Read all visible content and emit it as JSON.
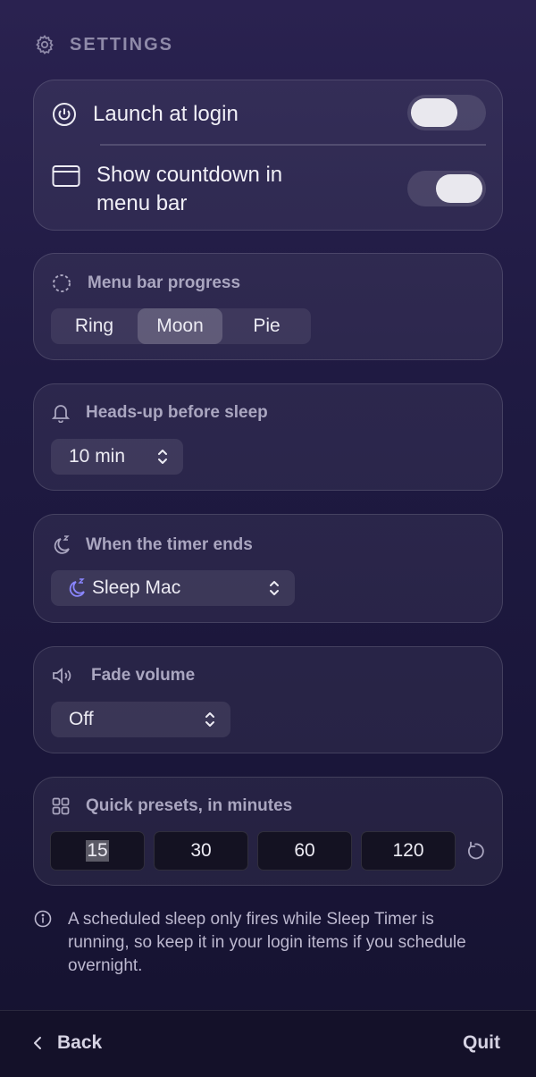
{
  "header": {
    "title": "SETTINGS",
    "icon": "gear-icon"
  },
  "general": {
    "launch_at_login": {
      "label": "Launch at login",
      "enabled": false,
      "icon": "power-icon"
    },
    "show_countdown": {
      "label_line1": "Show countdown in",
      "label_line2": "menu bar",
      "enabled": true,
      "icon": "window-icon"
    }
  },
  "menu_bar_progress": {
    "label": "Menu bar progress",
    "icon": "dashed-circle-icon",
    "options": [
      "Ring",
      "Moon",
      "Pie"
    ],
    "selected": "Moon"
  },
  "heads_up": {
    "label": "Heads-up before sleep",
    "icon": "bell-icon",
    "value": "10 min"
  },
  "timer_end": {
    "label": "When the timer ends",
    "icon": "moon-zzz-icon",
    "value": "Sleep Mac",
    "accent": "#8a86ff"
  },
  "fade_volume": {
    "label": "Fade volume",
    "icon": "speaker-icon",
    "value": "Off"
  },
  "quick_presets": {
    "label": "Quick presets, in minutes",
    "icon": "grid-icon",
    "values": [
      "15",
      "30",
      "60",
      "120"
    ],
    "reset_icon": "reset-icon"
  },
  "note": {
    "icon": "info-icon",
    "text": "A scheduled sleep only fires while Sleep Timer is running, so keep it in your login items if you schedule overnight."
  },
  "footer": {
    "back_label": "Back",
    "quit_label": "Quit"
  }
}
